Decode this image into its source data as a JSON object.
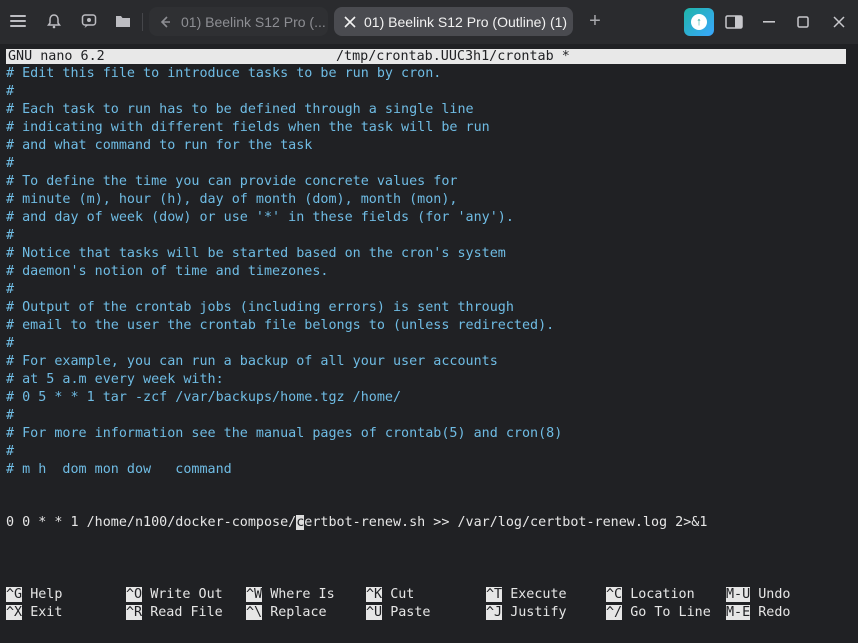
{
  "tabs": [
    {
      "label": "01) Beelink S12 Pro (...",
      "active": false,
      "icon": "back-arrow-icon"
    },
    {
      "label": "01) Beelink S12 Pro (Outline) (1)",
      "active": true,
      "icon": "close-icon"
    }
  ],
  "nano": {
    "version": "GNU nano 6.2",
    "filename": "/tmp/crontab.UUC3h1/crontab *"
  },
  "comment_lines": [
    "# Edit this file to introduce tasks to be run by cron.",
    "#",
    "# Each task to run has to be defined through a single line",
    "# indicating with different fields when the task will be run",
    "# and what command to run for the task",
    "#",
    "# To define the time you can provide concrete values for",
    "# minute (m), hour (h), day of month (dom), month (mon),",
    "# and day of week (dow) or use '*' in these fields (for 'any').",
    "#",
    "# Notice that tasks will be started based on the cron's system",
    "# daemon's notion of time and timezones.",
    "#",
    "# Output of the crontab jobs (including errors) is sent through",
    "# email to the user the crontab file belongs to (unless redirected).",
    "#",
    "# For example, you can run a backup of all your user accounts",
    "# at 5 a.m every week with:",
    "# 0 5 * * 1 tar -zcf /var/backups/home.tgz /home/",
    "#",
    "# For more information see the manual pages of crontab(5) and cron(8)",
    "#",
    "# m h  dom mon dow   command"
  ],
  "cron_entry": {
    "before_cursor": "0 0 * * 1 /home/n100/docker-compose/",
    "cursor_char": "c",
    "after_cursor": "ertbot-renew.sh >> /var/log/certbot-renew.log 2>&1"
  },
  "shortcuts_row1": [
    {
      "key": "^G",
      "label": "Help"
    },
    {
      "key": "^O",
      "label": "Write Out"
    },
    {
      "key": "^W",
      "label": "Where Is"
    },
    {
      "key": "^K",
      "label": "Cut"
    },
    {
      "key": "^T",
      "label": "Execute"
    },
    {
      "key": "^C",
      "label": "Location"
    },
    {
      "key": "M-U",
      "label": "Undo"
    }
  ],
  "shortcuts_row2": [
    {
      "key": "^X",
      "label": "Exit"
    },
    {
      "key": "^R",
      "label": "Read File"
    },
    {
      "key": "^\\",
      "label": "Replace"
    },
    {
      "key": "^U",
      "label": "Paste"
    },
    {
      "key": "^J",
      "label": "Justify"
    },
    {
      "key": "^/",
      "label": "Go To Line"
    },
    {
      "key": "M-E",
      "label": "Redo"
    }
  ],
  "colors": {
    "comment": "#6fbce4",
    "text": "#e6e6e6",
    "background": "#202124"
  }
}
